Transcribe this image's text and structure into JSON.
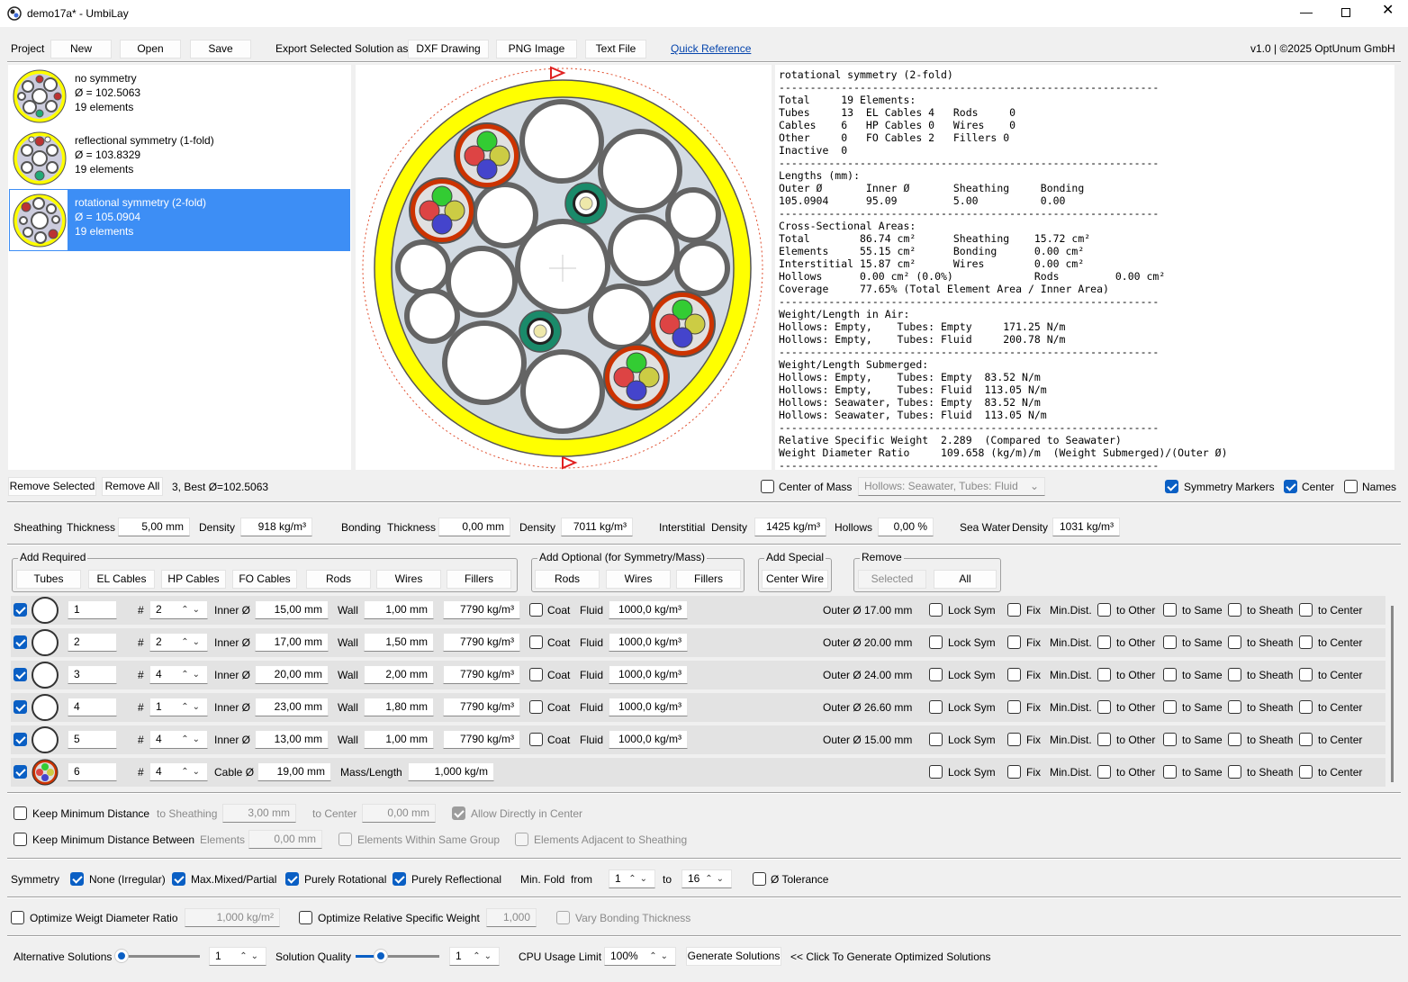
{
  "window": {
    "title": "demo17a* - UmbiLay"
  },
  "menu": {
    "project": "Project",
    "new": "New",
    "open": "Open",
    "save": "Save",
    "export_label": "Export Selected Solution as",
    "dxf": "DXF Drawing",
    "png": "PNG Image",
    "text": "Text File",
    "quick_ref": "Quick Reference",
    "version": "v1.0 | ©2025 OptUnum GmbH"
  },
  "solutions": [
    {
      "name": "no symmetry",
      "dia": "Ø = 102.5063",
      "count": "19 elements"
    },
    {
      "name": "reflectional symmetry (1-fold)",
      "dia": "Ø = 103.8329",
      "count": "19 elements"
    },
    {
      "name": "rotational symmetry (2-fold)",
      "dia": "Ø = 105.0904",
      "count": "19 elements"
    }
  ],
  "report": "rotational symmetry (2-fold)\n-------------------------------------------------------------\nTotal     19 Elements:\nTubes     13  EL Cables 4   Rods     0\nCables    6   HP Cables 0   Wires    0\nOther     0   FO Cables 2   Fillers 0\nInactive  0\n-------------------------------------------------------------\nLengths (mm):\nOuter Ø       Inner Ø       Sheathing     Bonding\n105.0904      95.09         5.00          0.00\n-------------------------------------------------------------\nCross-Sectional Areas:\nTotal        86.74 cm²      Sheathing    15.72 cm²\nElements     55.15 cm²      Bonding      0.00 cm²\nInterstitial 15.87 cm²      Wires        0.00 cm²\nHollows      0.00 cm² (0.0%)             Rods         0.00 cm²\nCoverage     77.65% (Total Element Area / Inner Area)\n-------------------------------------------------------------\nWeight/Length in Air:\nHollows: Empty,    Tubes: Empty     171.25 N/m\nHollows: Empty,    Tubes: Fluid     200.78 N/m\n-------------------------------------------------------------\nWeight/Length Submerged:\nHollows: Empty,    Tubes: Empty  83.52 N/m\nHollows: Empty,    Tubes: Fluid  113.05 N/m\nHollows: Seawater, Tubes: Empty  83.52 N/m\nHollows: Seawater, Tubes: Fluid  113.05 N/m\n-------------------------------------------------------------\nRelative Specific Weight  2.289  (Compared to Seawater)\nWeight Diameter Ratio     109.658 (kg/m)/m  (Weight Submerged)/(Outer Ø)\n-------------------------------------------------------------",
  "toolbar2": {
    "remove_selected": "Remove Selected",
    "remove_all": "Remove All",
    "best": "3, Best Ø=102.5063",
    "center_mass": "Center of Mass",
    "hollows_select": "Hollows: Seawater, Tubes: Fluid",
    "sym_markers": "Symmetry Markers",
    "center": "Center",
    "names": "Names"
  },
  "params": {
    "sheathing": "Sheathing",
    "thickness": "Thickness",
    "sheath_thick": "5,00 mm",
    "density": "Density",
    "sheath_dens": "918 kg/m³",
    "bonding": "Bonding",
    "bond_thick": "0,00 mm",
    "bond_dens": "7011 kg/m³",
    "interstitial": "Interstitial",
    "inter_dens": "1425 kg/m³",
    "hollows": "Hollows",
    "hollows_val": "0,00 %",
    "seawater": "Sea Water",
    "sea_dens": "1031 kg/m³"
  },
  "groups": {
    "add_required": "Add Required",
    "req": [
      "Tubes",
      "EL Cables",
      "HP Cables",
      "FO Cables",
      "Rods",
      "Wires",
      "Fillers"
    ],
    "add_optional": "Add Optional (for Symmetry/Mass)",
    "opt": [
      "Rods",
      "Wires",
      "Fillers"
    ],
    "add_special": "Add Special",
    "special": "Center Wire",
    "remove": "Remove",
    "rem_selected": "Selected",
    "rem_all": "All"
  },
  "rowlabels": {
    "hash": "#",
    "inner": "Inner Ø",
    "wall": "Wall",
    "coat": "Coat",
    "fluid": "Fluid",
    "lock": "Lock Sym",
    "fix": "Fix",
    "mindist": "Min.Dist.",
    "other": "to Other",
    "same": "to Same",
    "sheath": "to Sheath",
    "center": "to Center",
    "cable": "Cable Ø",
    "mass": "Mass/Length"
  },
  "rows": [
    {
      "id": "1",
      "n": "2",
      "inner": "15,00 mm",
      "wall": "1,00 mm",
      "dens": "7790 kg/m³",
      "fluid": "1000,0 kg/m³",
      "outer": "Outer Ø 17.00 mm"
    },
    {
      "id": "2",
      "n": "2",
      "inner": "17,00 mm",
      "wall": "1,50 mm",
      "dens": "7790 kg/m³",
      "fluid": "1000,0 kg/m³",
      "outer": "Outer Ø 20.00 mm"
    },
    {
      "id": "3",
      "n": "4",
      "inner": "20,00 mm",
      "wall": "2,00 mm",
      "dens": "7790 kg/m³",
      "fluid": "1000,0 kg/m³",
      "outer": "Outer Ø 24.00 mm"
    },
    {
      "id": "4",
      "n": "1",
      "inner": "23,00 mm",
      "wall": "1,80 mm",
      "dens": "7790 kg/m³",
      "fluid": "1000,0 kg/m³",
      "outer": "Outer Ø 26.60 mm"
    },
    {
      "id": "5",
      "n": "4",
      "inner": "13,00 mm",
      "wall": "1,00 mm",
      "dens": "7790 kg/m³",
      "fluid": "1000,0 kg/m³",
      "outer": "Outer Ø 15.00 mm"
    }
  ],
  "cable_row": {
    "id": "6",
    "n": "4",
    "cable": "19,00 mm",
    "mass": "1,000 kg/m"
  },
  "mindist": {
    "keep": "Keep Minimum Distance",
    "to_sheath": "to Sheathing",
    "sheath_val": "3,00 mm",
    "to_center": "to Center",
    "center_val": "0,00 mm",
    "allow": "Allow Directly in Center",
    "keep_between": "Keep Minimum Distance Between",
    "elements": "Elements",
    "el_val": "0,00 mm",
    "within": "Elements Within Same Group",
    "adjacent": "Elements Adjacent to Sheathing"
  },
  "symmetry": {
    "label": "Symmetry",
    "none": "None (Irregular)",
    "mixed": "Max.Mixed/Partial",
    "rot": "Purely Rotational",
    "refl": "Purely Reflectional",
    "minfold": "Min. Fold",
    "from": "from",
    "from_val": "1",
    "to": "to",
    "to_val": "16",
    "tol": "Ø Tolerance"
  },
  "optimize": {
    "wdr": "Optimize Weigt Diameter Ratio",
    "wdr_val": "1,000 kg/m²",
    "rsw": "Optimize Relative Specific Weight",
    "rsw_val": "1,000",
    "vary": "Vary Bonding Thickness"
  },
  "bottom": {
    "alt": "Alternative Solutions",
    "alt_val": "1",
    "quality": "Solution Quality",
    "q_val": "1",
    "cpu": "CPU Usage Limit",
    "cpu_val": "100%",
    "generate": "Generate Solutions",
    "hint": "<< Click To Generate Optimized Solutions"
  },
  "colors": {
    "accent": "#3d8ef5",
    "sheath": "#ffff00",
    "checkbox": "#0a5fc4"
  }
}
